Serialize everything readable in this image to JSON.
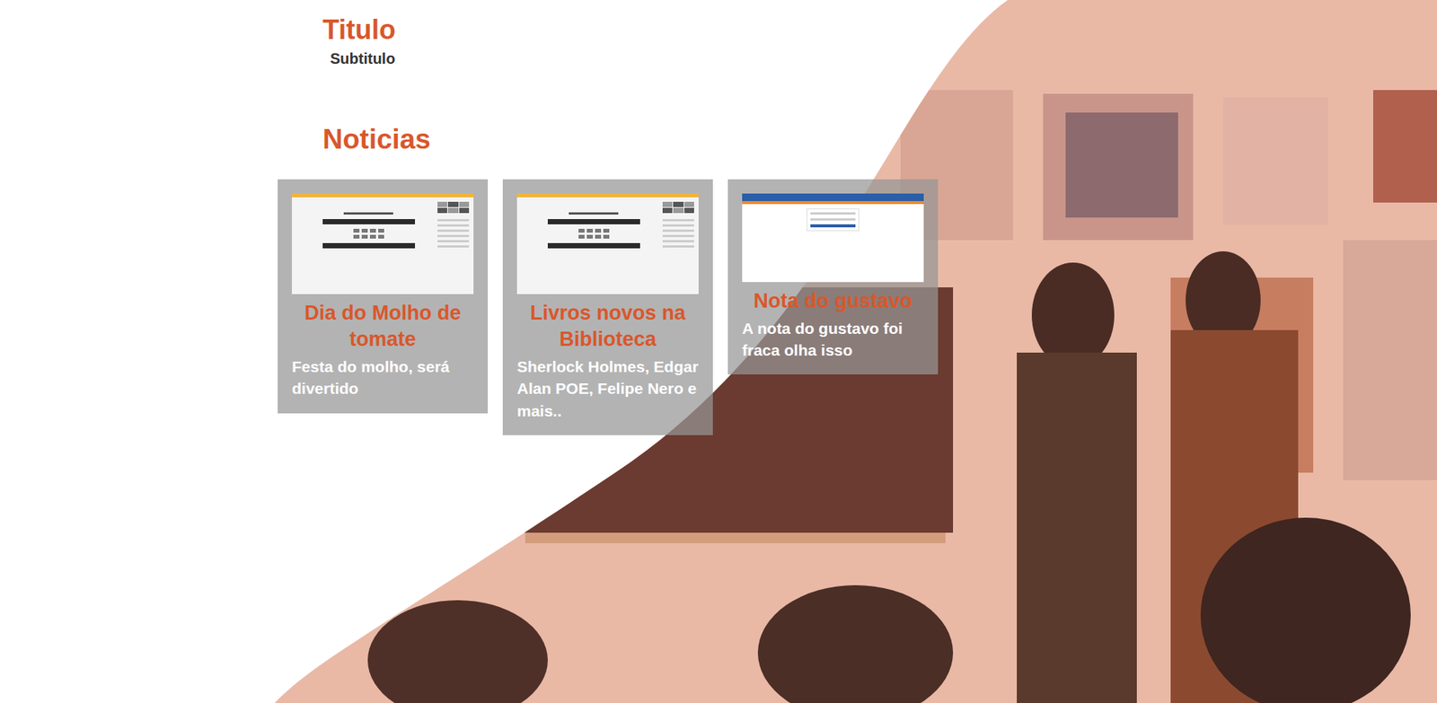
{
  "header": {
    "title": "Titulo",
    "subtitle": "Subtitulo"
  },
  "news": {
    "heading": "Noticias",
    "cards": [
      {
        "title": "Dia do Molho de tomate",
        "description": "Festa do molho, será divertido",
        "kind": "site"
      },
      {
        "title": "Livros novos na Biblioteca",
        "description": "Sherlock Holmes, Edgar Alan POE, Felipe Nero e mais..",
        "kind": "site"
      },
      {
        "title": "Nota do gustavo",
        "description": "A nota do gustavo foi fraca olha isso",
        "kind": "portal"
      }
    ]
  }
}
